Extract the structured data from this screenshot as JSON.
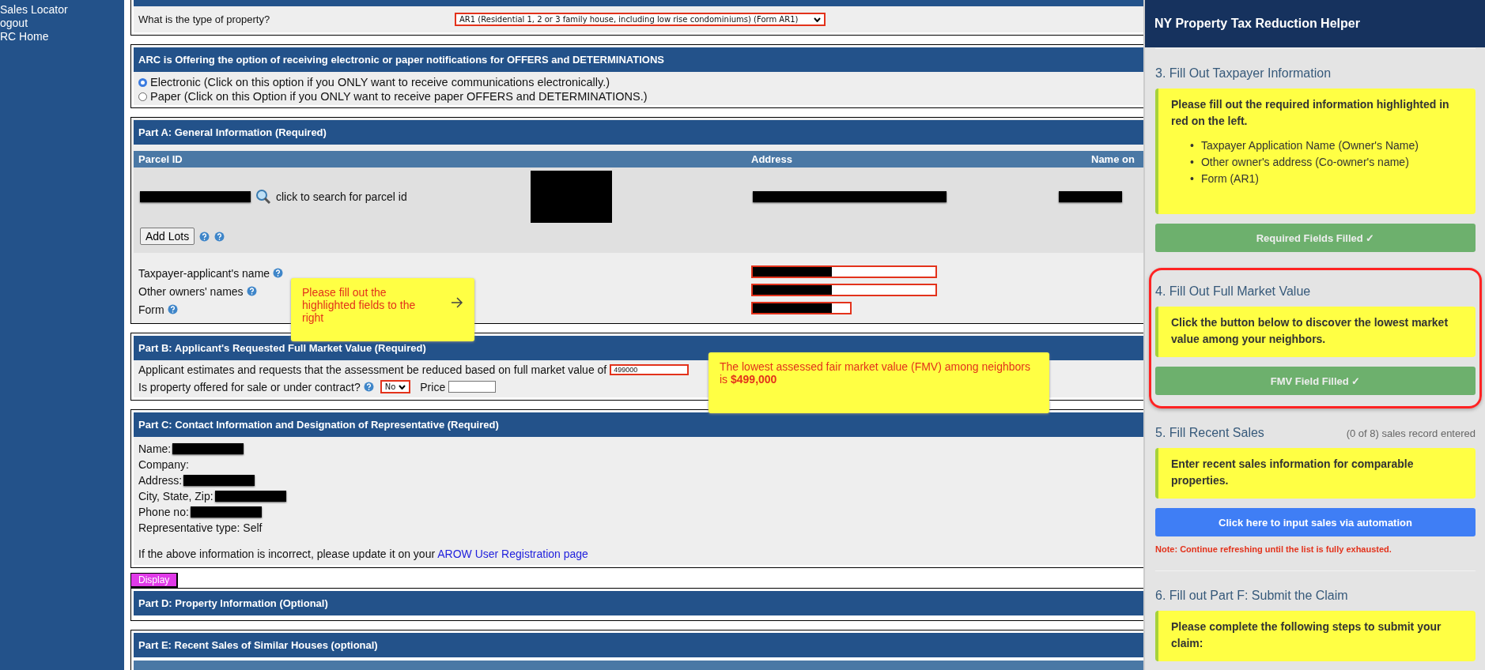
{
  "sidebar": {
    "links": [
      "Sales Locator",
      "ogout",
      "RC Home"
    ]
  },
  "property_type": {
    "label": "What is the type of property?",
    "value": "AR1 (Residential 1, 2 or 3 family house, including low rise condominiums) (Form AR1)",
    "highlighted": true
  },
  "notifications": {
    "title": "ARC is Offering the option of receiving electronic or paper notifications for OFFERS and DETERMINATIONS",
    "options": [
      {
        "label": "Electronic (Click on this option if you ONLY want to receive communications electronically.)",
        "selected": true
      },
      {
        "label": "Paper (Click on this Option if you ONLY want to receive paper OFFERS and DETERMINATIONS.)",
        "selected": false
      }
    ]
  },
  "part_a": {
    "title": "Part A: General Information (Required)",
    "columns": [
      "Parcel ID",
      "Address",
      "Name on"
    ],
    "search_link": "click to search for parcel id",
    "add_lots": "Add Lots",
    "fields": [
      {
        "label": "Taxpayer-applicant's name",
        "kind": "text",
        "highlighted": true
      },
      {
        "label": "Other owners' names",
        "kind": "text",
        "highlighted": true
      },
      {
        "label": "Form",
        "kind": "select",
        "highlighted": true
      }
    ]
  },
  "fields_hint": {
    "text": "Please fill out the highlighted fields to the right"
  },
  "part_b": {
    "title": "Part B: Applicant's Requested Full Market Value (Required)",
    "value_label": "Applicant estimates and requests that the assessment be reduced based on full market value of",
    "value": "499000",
    "value_highlighted": true,
    "sale_label": "Is property offered for sale or under contract?",
    "sale_value": "No",
    "sale_highlighted": true,
    "price_label": "Price"
  },
  "fmv_hint": {
    "text": "The lowest assessed fair market value (FMV) among neighbors is **$499,000**"
  },
  "part_c": {
    "title": "Part C: Contact Information and Designation of Representative (Required)",
    "rows": [
      {
        "label": "Name:",
        "redacted": true
      },
      {
        "label": "Company:",
        "redacted": false
      },
      {
        "label": "Address:",
        "redacted": true
      },
      {
        "label": "City, State, Zip:",
        "redacted": true
      },
      {
        "label": "Phone no:",
        "redacted": true
      },
      {
        "label": "Representative type: Self",
        "redacted": false
      }
    ],
    "note": "If the above information is incorrect, please update it on your",
    "link": "AROW User Registration page"
  },
  "display_button": "Display",
  "part_d": {
    "title": "Part D: Property Information (Optional)"
  },
  "part_e": {
    "title": "Part E: Recent Sales of Similar Houses (optional)"
  },
  "helper": {
    "title": "NY Property Tax Reduction Helper",
    "steps": [
      {
        "title": "3. Fill Out Taxpayer Information",
        "highlighted": false,
        "bullet_marker": "•",
        "message": "Please fill out the required information highlighted in red on the left.",
        "bullets": [
          "Taxpayer Application Name (Owner's Name)",
          "Other owner's address (Co-owner's name)",
          "Form (AR1)"
        ],
        "button": {
          "label": "Required Fields Filled ✓",
          "kind": "done"
        }
      },
      {
        "title": "4. Fill Out Full Market Value",
        "highlighted": true,
        "message": "Click the button below to discover the lowest market value among your neighbors.",
        "button": {
          "label": "FMV Field Filled ✓",
          "kind": "done"
        }
      },
      {
        "title": "5. Fill Recent Sales",
        "highlighted": false,
        "count": "(0 of 8) sales record entered",
        "message": "Enter recent sales information for comparable properties.",
        "button": {
          "label": "Click here to input sales via automation",
          "kind": "action"
        },
        "note": "Note: Continue refreshing until the list is fully exhausted."
      },
      {
        "title": "6. Fill out Part F: Submit the Claim",
        "highlighted": false,
        "message": "Please complete the following steps to submit your claim:"
      }
    ]
  }
}
